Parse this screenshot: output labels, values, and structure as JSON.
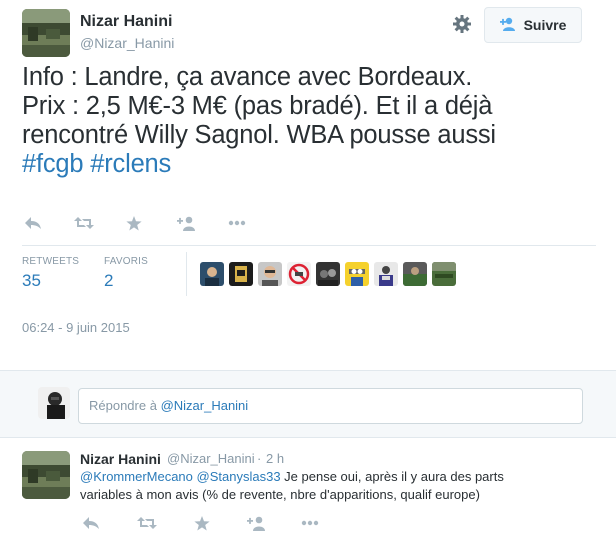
{
  "author": {
    "name": "Nizar Hanini",
    "handle": "@Nizar_Hanini"
  },
  "follow_button": {
    "label": "Suivre"
  },
  "tweet": {
    "text_lines": [
      "Info : Landre, ça avance avec Bordeaux.",
      "Prix : 2,5 M€-3 M€ (pas bradé). Et il a déjà",
      "rencontré Willy Sagnol. WBA pousse aussi"
    ],
    "hashtags": [
      "#fcgb",
      "#rclens"
    ],
    "timestamp": "06:24 - 9 juin 2015"
  },
  "stats": {
    "retweets_label": "RETWEETS",
    "retweets_count": "35",
    "favorites_label": "FAVORIS",
    "favorites_count": "2"
  },
  "reply_box": {
    "placeholder_prefix": "Répondre à ",
    "placeholder_mention": "@Nizar_Hanini"
  },
  "reply": {
    "name": "Nizar Hanini",
    "handle": "@Nizar_Hanini",
    "separator": "·",
    "time": "2 h",
    "mention1": "@KrommerMecano",
    "mention2": "@Stanyslas33",
    "text_line1": " Je pense oui, après il y aura des parts",
    "text_line2": "variables à mon avis (% de revente, nbre d'apparitions, qualif europe)"
  },
  "icons": {
    "actions": [
      "reply-icon",
      "retweet-icon",
      "favorite-icon",
      "follow-icon",
      "more-icon"
    ],
    "gear": "gear-icon",
    "follow": "follow-person-icon"
  },
  "colors": {
    "link": "#2b7bb9",
    "muted": "#8899a6",
    "icon": "#aab8c2",
    "text": "#292f33"
  }
}
